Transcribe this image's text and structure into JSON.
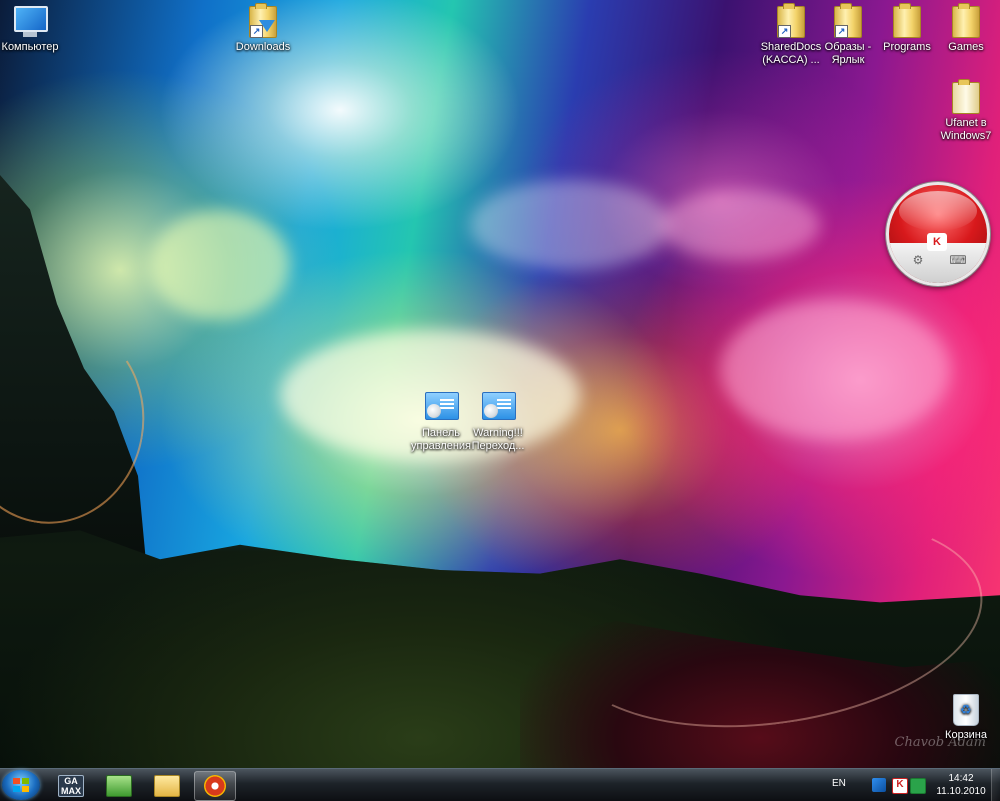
{
  "desktop": {
    "icons": [
      {
        "label": "Компьютер",
        "kind": "computer-icon"
      },
      {
        "label": "Downloads",
        "kind": "folder-shortcut-icon"
      },
      {
        "label": "SharedDocs (KACCA) ...",
        "kind": "folder-shortcut-icon"
      },
      {
        "label": "Образы - Ярлык",
        "kind": "folder-shortcut-icon"
      },
      {
        "label": "Programs",
        "kind": "folder-icon"
      },
      {
        "label": "Games",
        "kind": "folder-icon"
      },
      {
        "label": "Ufanet в Windows7",
        "kind": "document-icon"
      },
      {
        "label": "Панель управления",
        "kind": "control-panel-icon"
      },
      {
        "label": "Warning!!! Переход...",
        "kind": "control-panel-icon"
      },
      {
        "label": "Корзина",
        "kind": "recycle-bin-icon"
      }
    ],
    "wallpaper_signature": "Chavob Adam"
  },
  "gadget": {
    "name": "kaspersky-gadget",
    "logo": "K",
    "left_button": "settings-gear-icon",
    "right_button": "keyboard-icon"
  },
  "taskbar": {
    "start_label": "Start",
    "pinned": [
      {
        "name": "gamax-app",
        "label": "GA MAX"
      },
      {
        "name": "money-app",
        "label": ""
      },
      {
        "name": "explorer-app",
        "label": ""
      },
      {
        "name": "browser-app",
        "label": ""
      }
    ],
    "tray": {
      "language": "EN",
      "time": "14:42",
      "date": "11.10.2010"
    }
  },
  "colors": {
    "taskbar": "#141a20",
    "gadget_red": "#d8191c",
    "start_orb": "#1a6cc0"
  }
}
